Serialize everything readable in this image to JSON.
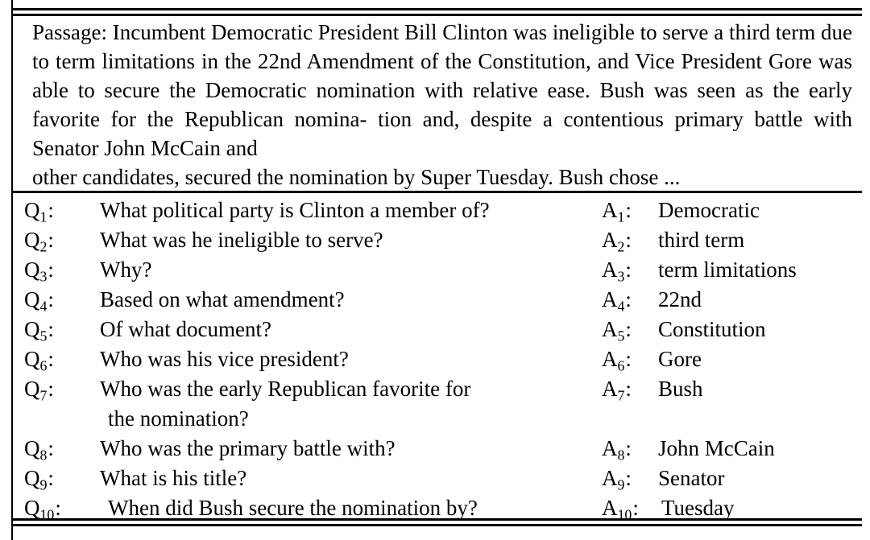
{
  "passage": {
    "label": "Passage:",
    "lines": [
      "Passage: Incumbent Democratic President Bill Clinton was ineligible to serve",
      "a third term due to term limitations in the 22nd Amendment of the Constitution,",
      "and Vice President Gore was able to secure the Democratic nomination with",
      "relative ease. Bush was seen as the early favorite for the Republican nomina-",
      "tion and, despite a contentious primary battle with Senator John McCain and",
      "other candidates, secured the nomination by Super Tuesday. Bush chose ..."
    ],
    "full_text": "Passage: Incumbent Democratic President Bill Clinton was ineligible to serve a third term due to term limitations in the 22nd Amendment of the Constitution, and Vice President Gore was able to secure the Democratic nomination with relative ease. Bush was seen as the early favorite for the Republican nomination and, despite a contentious primary battle with Senator John McCain and other candidates, secured the nomination by Super Tuesday. Bush chose ..."
  },
  "qa": {
    "question_prefix": "Q",
    "answer_prefix": "A",
    "separator": ":",
    "rows": [
      {
        "n": "1",
        "question": "What political party is Clinton a member of?",
        "question_cont": "",
        "answer": "Democratic"
      },
      {
        "n": "2",
        "question": "What was he ineligible to serve?",
        "question_cont": "",
        "answer": "third term"
      },
      {
        "n": "3",
        "question": "Why?",
        "question_cont": "",
        "answer": "term limitations"
      },
      {
        "n": "4",
        "question": "Based on what amendment?",
        "question_cont": "",
        "answer": "22nd"
      },
      {
        "n": "5",
        "question": "Of what document?",
        "question_cont": "",
        "answer": "Constitution"
      },
      {
        "n": "6",
        "question": "Who was his vice president?",
        "question_cont": "",
        "answer": "Gore"
      },
      {
        "n": "7",
        "question": "Who was the early Republican favorite for",
        "question_cont": "the nomination?",
        "answer": "Bush"
      },
      {
        "n": "8",
        "question": "Who was the primary battle with?",
        "question_cont": "",
        "answer": "John McCain"
      },
      {
        "n": "9",
        "question": "What is his title?",
        "question_cont": "",
        "answer": "Senator"
      },
      {
        "n": "10",
        "question": "When did Bush secure the nomination by?",
        "question_cont": "",
        "answer": "Tuesday"
      }
    ]
  },
  "style": {
    "rule_color": "#000000",
    "text_color": "#000000",
    "background": "#ffffff"
  }
}
